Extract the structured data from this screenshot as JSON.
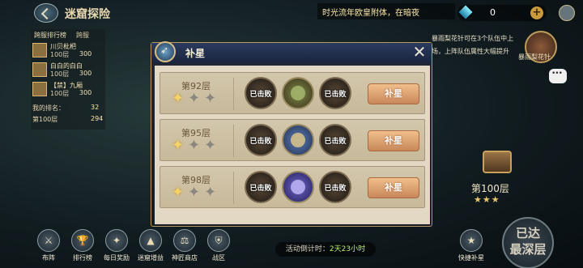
{
  "header": {
    "title": "迷窟探险",
    "banner": "时光流年欧皇附体，在暗夜",
    "resource": {
      "value": "0",
      "icon": "diamond-gem-icon"
    }
  },
  "ranking": {
    "title": "跨服排行榜",
    "cross_server": "跨服",
    "entries": [
      {
        "name": "川贝枇杷",
        "floor": "100层",
        "score": "300"
      },
      {
        "name": "白白的白白",
        "floor": "100层",
        "score": "300"
      },
      {
        "name": "【禁】九厢",
        "floor": "100层",
        "score": "300"
      }
    ],
    "my_rank_label": "我的排名：",
    "my_rank_value": "32",
    "my_floor": "第100层",
    "my_score": "294"
  },
  "side": {
    "description_lines": [
      "暴雨梨花针可在3个队伍中上",
      "场，上阵队伍属性大幅提升"
    ],
    "icon_label": "暴雨梨花针",
    "floor_label": "第100层",
    "floor_stars": "★★★",
    "deepest_line1": "已达",
    "deepest_line2": "最深层"
  },
  "bottom_nav": [
    {
      "label": "布阵",
      "icon": "formation-icon",
      "glyph": "⚔"
    },
    {
      "label": "排行榜",
      "icon": "trophy-icon",
      "glyph": "🏆"
    },
    {
      "label": "每日奖励",
      "icon": "gift-chest-icon",
      "glyph": "✦"
    },
    {
      "label": "迷窟增益",
      "icon": "buff-icon",
      "glyph": "▲"
    },
    {
      "label": "神匠商店",
      "icon": "shop-scales-icon",
      "glyph": "⚖"
    },
    {
      "label": "战区",
      "icon": "war-zone-icon",
      "glyph": "⛨"
    }
  ],
  "countdown": {
    "label": "活动倒计时：",
    "value": "2天23小时"
  },
  "quick_star": {
    "label": "快捷补星",
    "glyph": "★"
  },
  "dialog": {
    "title": "补星",
    "rows": [
      {
        "floor": "第92层",
        "stars": [
          true,
          false,
          false
        ],
        "enemies": [
          {
            "state": "defeated",
            "label": "已击败"
          },
          {
            "state": "active",
            "label": ""
          },
          {
            "state": "defeated",
            "label": "已击败"
          }
        ],
        "button": "补星"
      },
      {
        "floor": "第95层",
        "stars": [
          true,
          false,
          false
        ],
        "enemies": [
          {
            "state": "defeated",
            "label": "已击败"
          },
          {
            "state": "active",
            "label": ""
          },
          {
            "state": "defeated",
            "label": "已击败"
          }
        ],
        "button": "补星"
      },
      {
        "floor": "第98层",
        "stars": [
          true,
          false,
          false
        ],
        "enemies": [
          {
            "state": "defeated",
            "label": "已击败"
          },
          {
            "state": "active",
            "label": ""
          },
          {
            "state": "defeated",
            "label": "已击败"
          }
        ],
        "button": "补星"
      }
    ]
  }
}
